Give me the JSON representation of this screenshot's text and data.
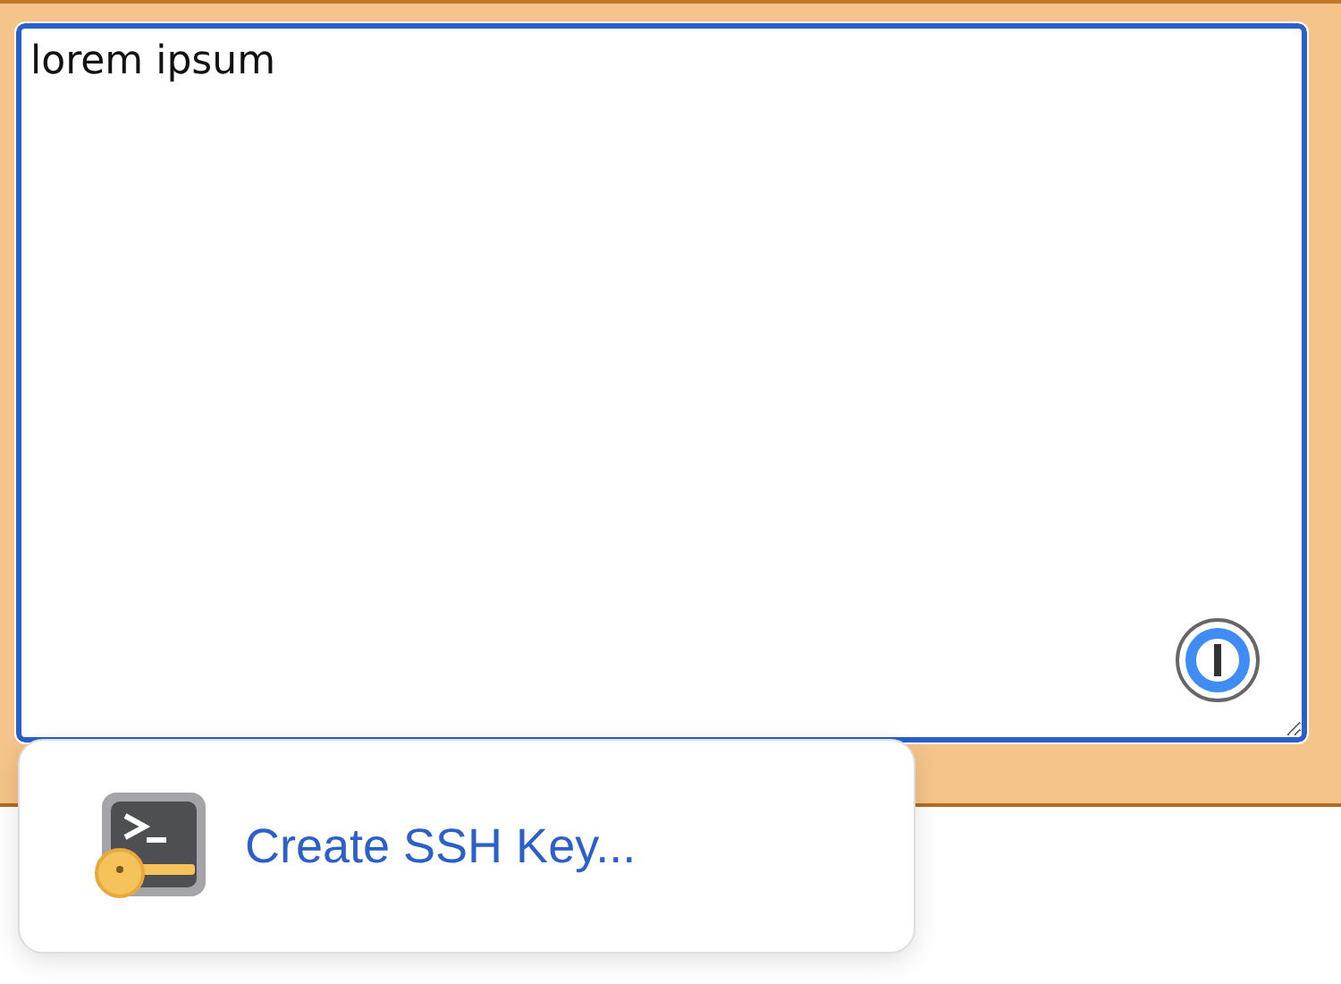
{
  "editor": {
    "value": "lorem ipsum",
    "focused": true
  },
  "suggestions": [
    {
      "label": "Create SSH Key..."
    }
  ]
}
